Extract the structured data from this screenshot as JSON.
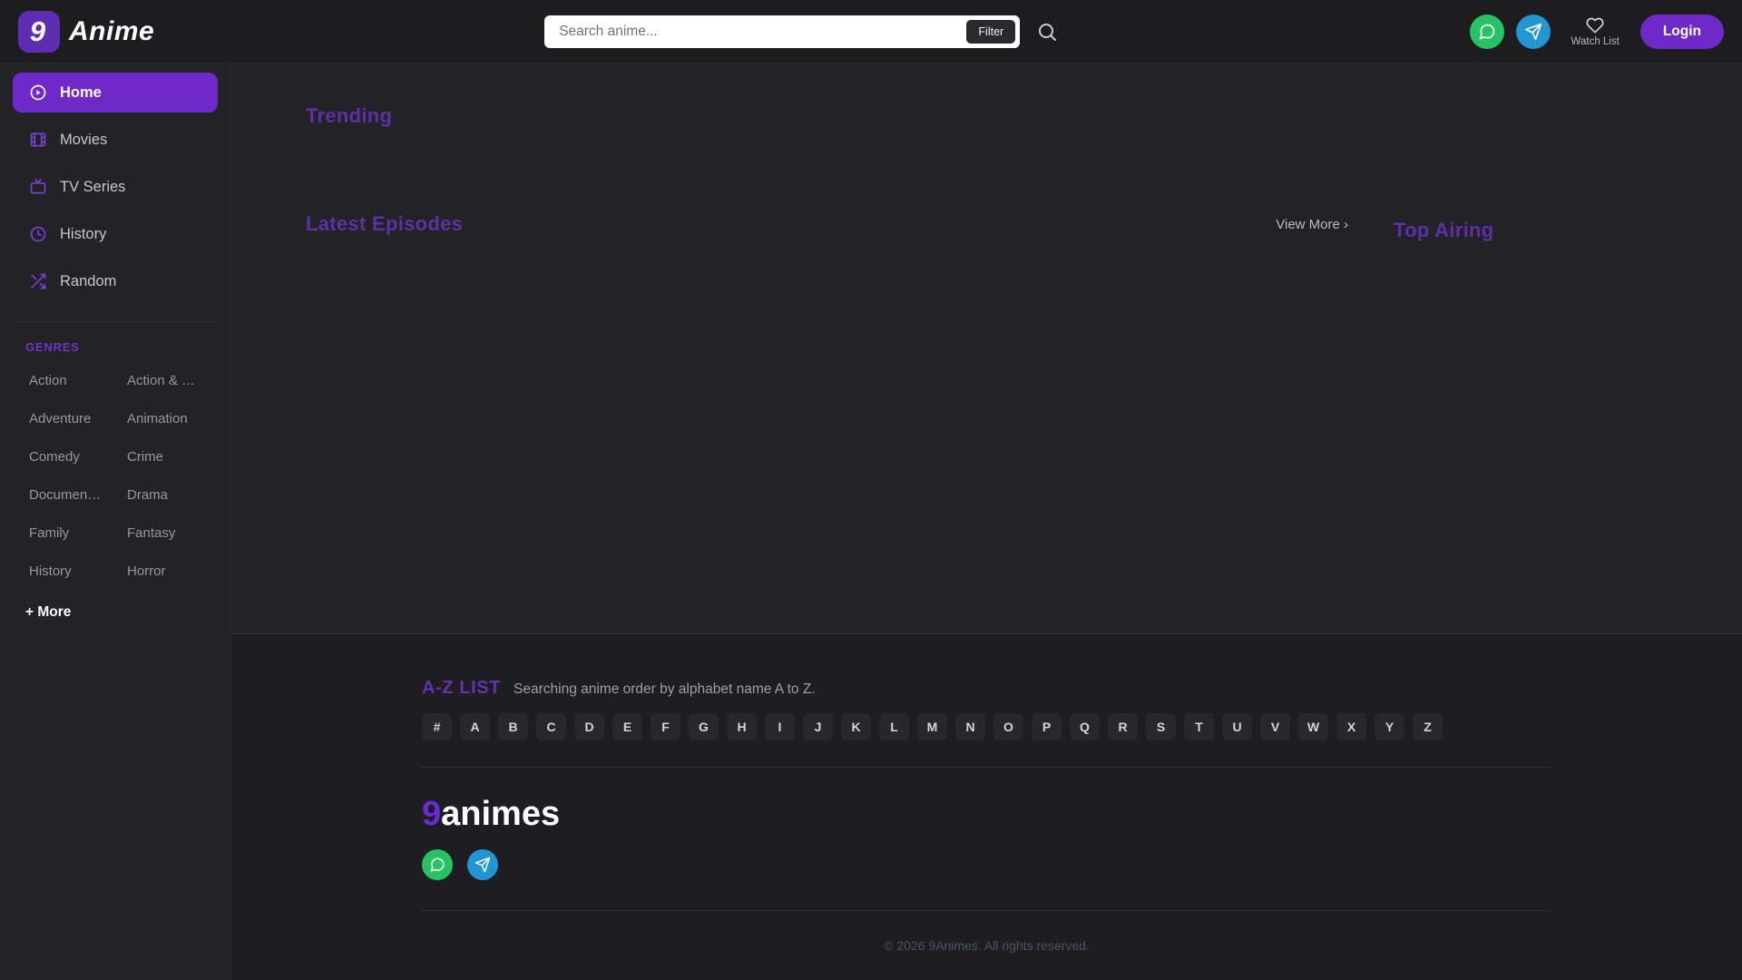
{
  "colors": {
    "accent": "#6f29c8",
    "heading_purple": "#5f2fa5",
    "logo_purple": "#5f2db2",
    "green": "#27c263",
    "telegram_blue": "#2196d3"
  },
  "header": {
    "logo": {
      "badge": "9",
      "text": "Anime"
    },
    "search": {
      "placeholder": "Search anime...",
      "filter_label": "Filter",
      "search_icon": "search-icon"
    },
    "social": [
      {
        "icon": "chat-bubble-icon"
      },
      {
        "icon": "telegram-icon"
      }
    ],
    "watch_list": {
      "icon": "heart-icon",
      "label": "Watch List"
    },
    "login_label": "Login"
  },
  "sidebar": {
    "nav": [
      {
        "label": "Home",
        "icon": "play-circle-icon",
        "active": true
      },
      {
        "label": "Movies",
        "icon": "film-icon",
        "active": false
      },
      {
        "label": "TV Series",
        "icon": "tv-icon",
        "active": false
      },
      {
        "label": "History",
        "icon": "clock-icon",
        "active": false
      },
      {
        "label": "Random",
        "icon": "shuffle-icon",
        "active": false
      }
    ],
    "genres_title": "GENRES",
    "genres": [
      "Action",
      "Action & …",
      "Adventure",
      "Animation",
      "Comedy",
      "Crime",
      "Documen…",
      "Drama",
      "Family",
      "Fantasy",
      "History",
      "Horror"
    ],
    "more_label": "+ More"
  },
  "main": {
    "trending_title": "Trending",
    "latest_title": "Latest Episodes",
    "view_more_label": "View More ›",
    "top_airing_title": "Top Airing"
  },
  "footer": {
    "az_title": "A-Z LIST",
    "az_subtitle": "Searching anime order by alphabet name A to Z.",
    "alphabet": [
      "#",
      "A",
      "B",
      "C",
      "D",
      "E",
      "F",
      "G",
      "H",
      "I",
      "J",
      "K",
      "L",
      "M",
      "N",
      "O",
      "P",
      "Q",
      "R",
      "S",
      "T",
      "U",
      "V",
      "W",
      "X",
      "Y",
      "Z"
    ],
    "logo_accent": "9",
    "logo_rest": "animes",
    "social": [
      {
        "icon": "chat-bubble-icon"
      },
      {
        "icon": "telegram-icon"
      }
    ],
    "copyright": "© 2026 9Animes. All rights reserved."
  }
}
